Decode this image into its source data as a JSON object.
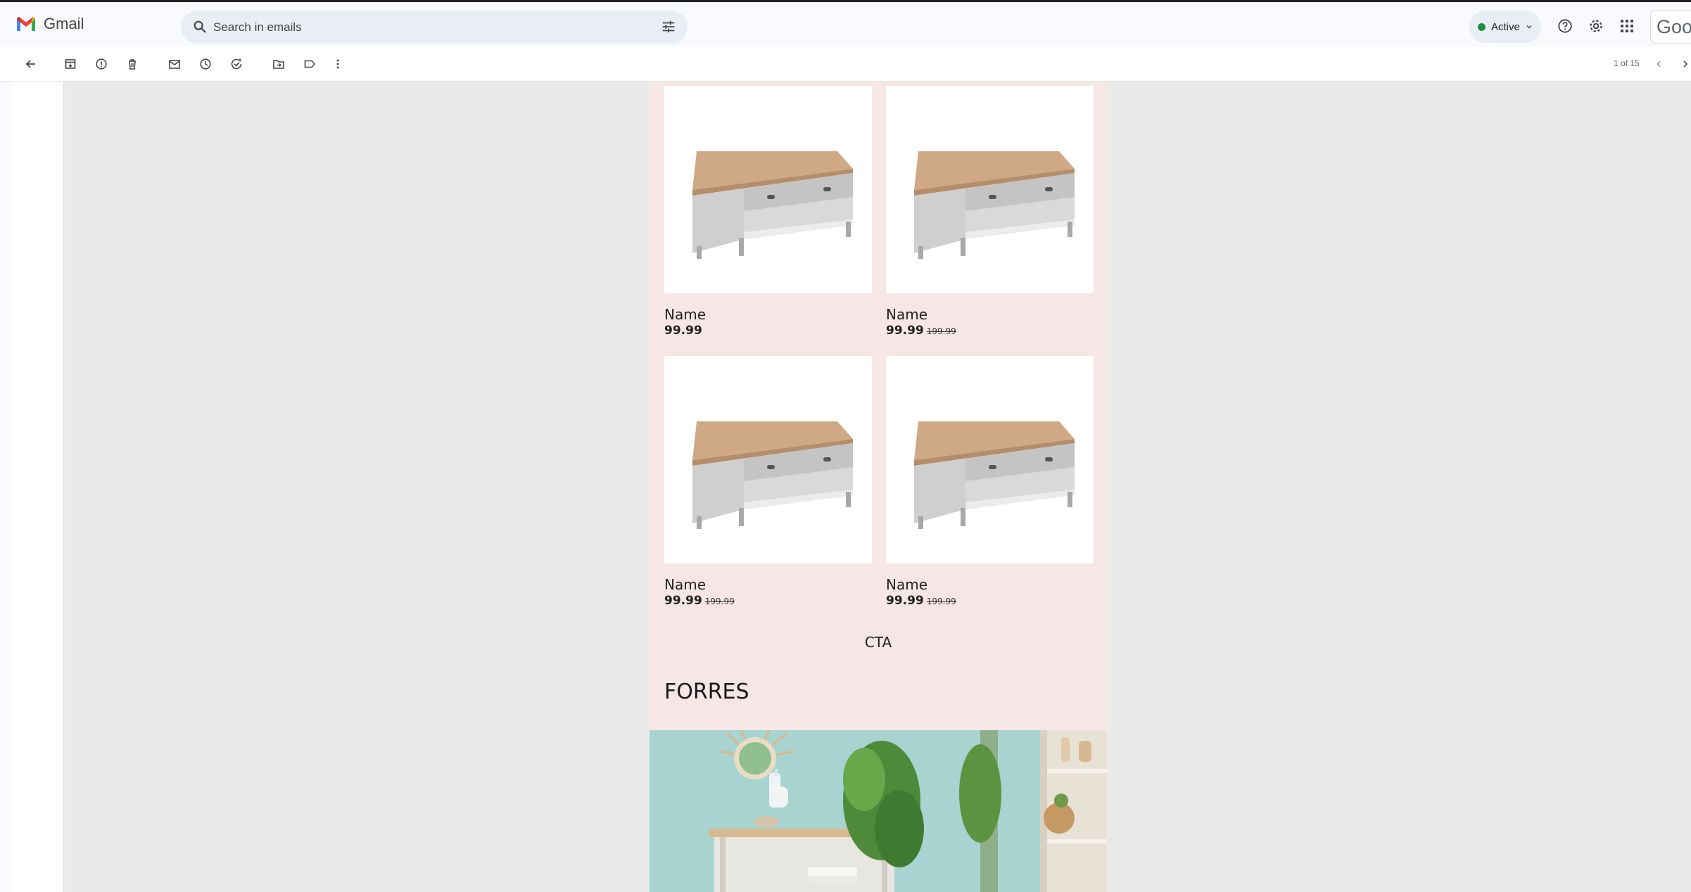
{
  "app": {
    "name": "Gmail"
  },
  "search": {
    "placeholder": "Search in emails"
  },
  "status": {
    "label": "Active",
    "color": "#1e8e3e"
  },
  "account": {
    "label": "Goog"
  },
  "toolbar": {
    "pager": "1 of 15"
  },
  "icons": {
    "header": [
      "search-icon",
      "filter-icon",
      "status-chevron-icon",
      "help-icon",
      "settings-icon",
      "apps-icon"
    ],
    "toolbar": [
      "back-arrow-icon",
      "archive-icon",
      "report-spam-icon",
      "delete-icon",
      "mark-unread-icon",
      "snooze-icon",
      "add-to-tasks-icon",
      "move-to-icon",
      "label-icon",
      "more-icon",
      "prev-chevron-icon",
      "next-chevron-icon"
    ]
  },
  "email": {
    "background": "#f6e6e6",
    "products": [
      {
        "name": "Name",
        "price": "99.99",
        "old_price": ""
      },
      {
        "name": "Name",
        "price": "99.99",
        "old_price": "199.99"
      },
      {
        "name": "Name",
        "price": "99.99",
        "old_price": "199.99"
      },
      {
        "name": "Name",
        "price": "99.99",
        "old_price": "199.99"
      }
    ],
    "cta": "CTA",
    "section_title": "FORRES"
  }
}
